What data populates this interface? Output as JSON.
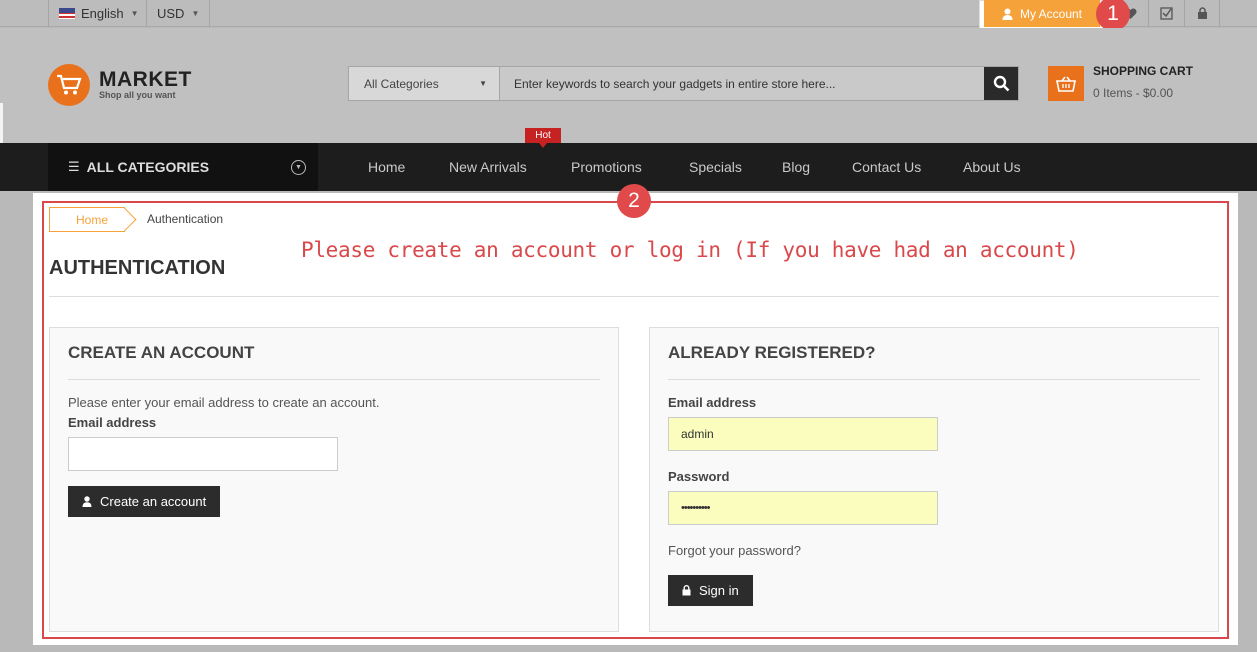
{
  "topbar": {
    "language": "English",
    "currency": "USD",
    "my_account": "My Account",
    "badge1": "1"
  },
  "header": {
    "logo_title": "MARKET",
    "logo_tagline": "Shop all you want",
    "search_category": "All Categories",
    "search_placeholder": "Enter keywords to search your gadgets in entire store here...",
    "cart_title": "SHOPPING CART",
    "cart_summary": "0 Items - $0.00"
  },
  "nav": {
    "all_categories": "ALL CATEGORIES",
    "hot_label": "Hot",
    "items": [
      "Home",
      "New Arrivals",
      "Promotions",
      "Specials",
      "Blog",
      "Contact Us",
      "About Us"
    ]
  },
  "main": {
    "badge2": "2",
    "breadcrumb_home": "Home",
    "breadcrumb_current": "Authentication",
    "annotation": "Please create an account or log in (If you have had an account)",
    "page_title": "AUTHENTICATION",
    "create": {
      "title": "CREATE AN ACCOUNT",
      "instruction": "Please enter your email address to create an account.",
      "email_label": "Email address",
      "email_value": "",
      "button": "Create an account"
    },
    "login": {
      "title": "ALREADY REGISTERED?",
      "email_label": "Email address",
      "email_value": "admin",
      "password_label": "Password",
      "password_value": "••••••••••",
      "forgot": "Forgot your password?",
      "button": "Sign in"
    }
  },
  "colors": {
    "accent": "#f6a23b",
    "brand": "#e9711c",
    "annotation_red": "#d9484a",
    "nav_bg": "#1d1d1d"
  },
  "icons": [
    "flag-icon",
    "user-icon",
    "heart-icon",
    "checklist-icon",
    "lock-icon",
    "cart-logo-icon",
    "search-icon",
    "basket-icon",
    "list-icon",
    "chevron-circle-icon"
  ]
}
